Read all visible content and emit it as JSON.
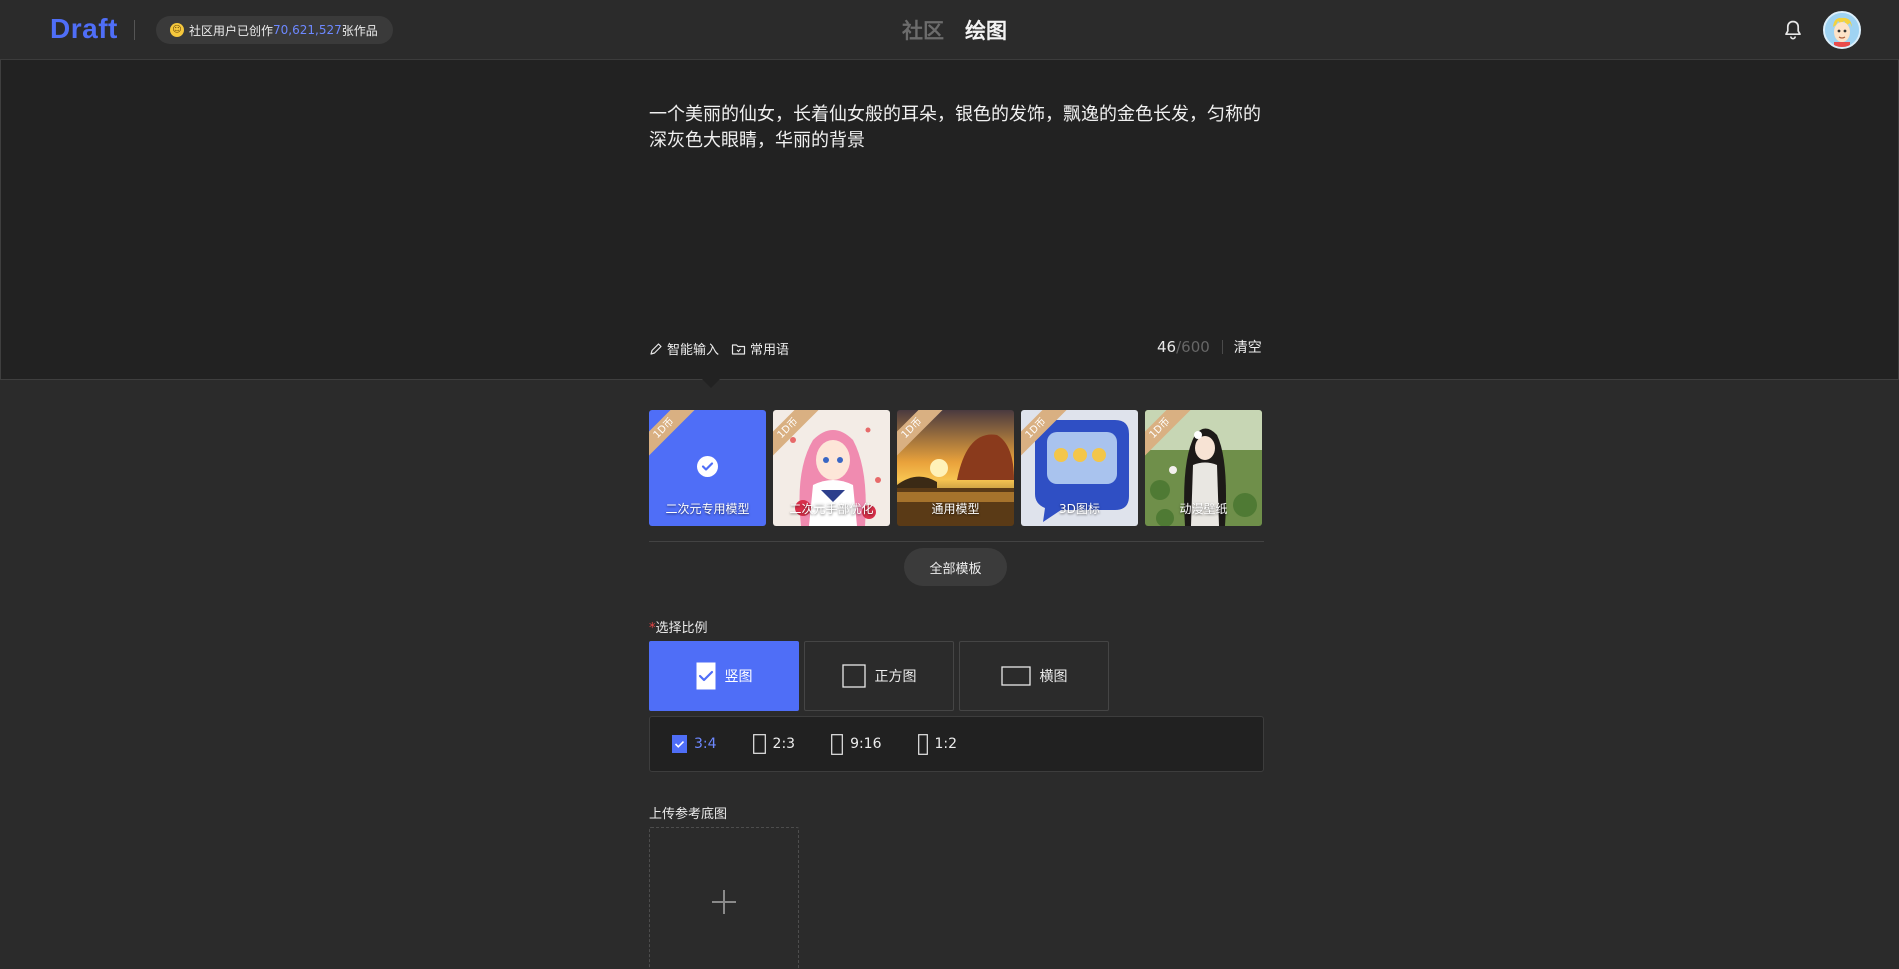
{
  "header": {
    "logo": "Draft",
    "stats": {
      "prefix": "社区用户已创作",
      "count": "70,621,527",
      "suffix": "张作品"
    },
    "tabs": [
      {
        "label": "社区"
      },
      {
        "label": "绘图"
      }
    ]
  },
  "prompt": {
    "text": "一个美丽的仙女，长着仙女般的耳朵，银色的发饰，飘逸的金色长发，匀称的深灰色大眼睛，华丽的背景",
    "tools": {
      "smart_input": "智能输入",
      "phrases": "常用语"
    },
    "count": "46",
    "max": "/600",
    "clear": "清空"
  },
  "models": [
    {
      "label": "二次元专用模型",
      "badge": "1D币",
      "selected": true
    },
    {
      "label": "二次元手部优化",
      "badge": "1D币",
      "selected": false
    },
    {
      "label": "通用模型",
      "badge": "1D币",
      "selected": false
    },
    {
      "label": "3D图标",
      "badge": "1D币",
      "selected": false
    },
    {
      "label": "动漫壁纸",
      "badge": "1D币",
      "selected": false
    }
  ],
  "all_templates": "全部模板",
  "ratio": {
    "required_mark": "*",
    "title": "选择比例",
    "options": [
      {
        "label": "竖图",
        "selected": true
      },
      {
        "label": "正方图",
        "selected": false
      },
      {
        "label": "横图",
        "selected": false
      }
    ],
    "sub_options": [
      {
        "label": "3:4",
        "selected": true
      },
      {
        "label": "2:3",
        "selected": false
      },
      {
        "label": "9:16",
        "selected": false
      },
      {
        "label": "1:2",
        "selected": false
      }
    ]
  },
  "upload": {
    "title": "上传参考底图"
  },
  "colors": {
    "accent": "#4f6ef7",
    "background": "#2b2b2b",
    "panel": "#222222"
  }
}
